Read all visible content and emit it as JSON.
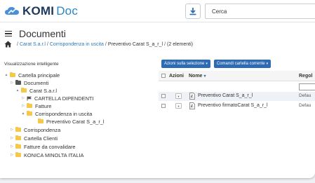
{
  "app": {
    "logo_main": "KOMI",
    "logo_sub": "Doc"
  },
  "header": {
    "search_placeholder": "Cerca"
  },
  "page": {
    "title": "Documenti"
  },
  "breadcrumb": {
    "items": [
      "Carat S.a.r.l",
      "Corrispondenza in uscita"
    ],
    "current": "Preventivo Carat S_a_r_l",
    "count": "(2 elementi)",
    "separator": "/"
  },
  "sidebar": {
    "heading": "Visualizzazione intelligente",
    "tree": [
      {
        "label": "Cartella principale",
        "caret": "▲"
      },
      {
        "label": "Documenti",
        "caret": "▷"
      },
      {
        "label": "Carat S.a.r.l",
        "caret": "▲"
      },
      {
        "label": "CARTELLA DIPENDENTI",
        "caret": "▷"
      },
      {
        "label": "Fatture",
        "caret": "▷"
      },
      {
        "label": "Corrispondenza in uscita",
        "caret": "▲"
      },
      {
        "label": "Preventivo Carat S_a_r_l",
        "caret": ""
      },
      {
        "label": "Corrispondenza",
        "caret": "▷"
      },
      {
        "label": "Cartella Clienti",
        "caret": "▷"
      },
      {
        "label": "Fatture da convalidare",
        "caret": "▷"
      },
      {
        "label": "KONICA MINOLTA ITALIA",
        "caret": "▷"
      }
    ]
  },
  "toolbar": {
    "selection_actions": "Azioni sulla selezione",
    "folder_commands": "Comandi cartella corrente"
  },
  "grid": {
    "columns": [
      "Azioni",
      "Nome",
      "Regol"
    ],
    "sort_icon": "▾",
    "rows": [
      {
        "name": "Preventivo Carat S_a_r_l",
        "value": "Defau"
      },
      {
        "name": "Preventivo firmatoCarat S_a_r_l",
        "value": "Defau"
      }
    ]
  },
  "colors": {
    "accent": "#2d6cb5",
    "folder": "#f4c84a",
    "link": "#2a7ab8"
  }
}
